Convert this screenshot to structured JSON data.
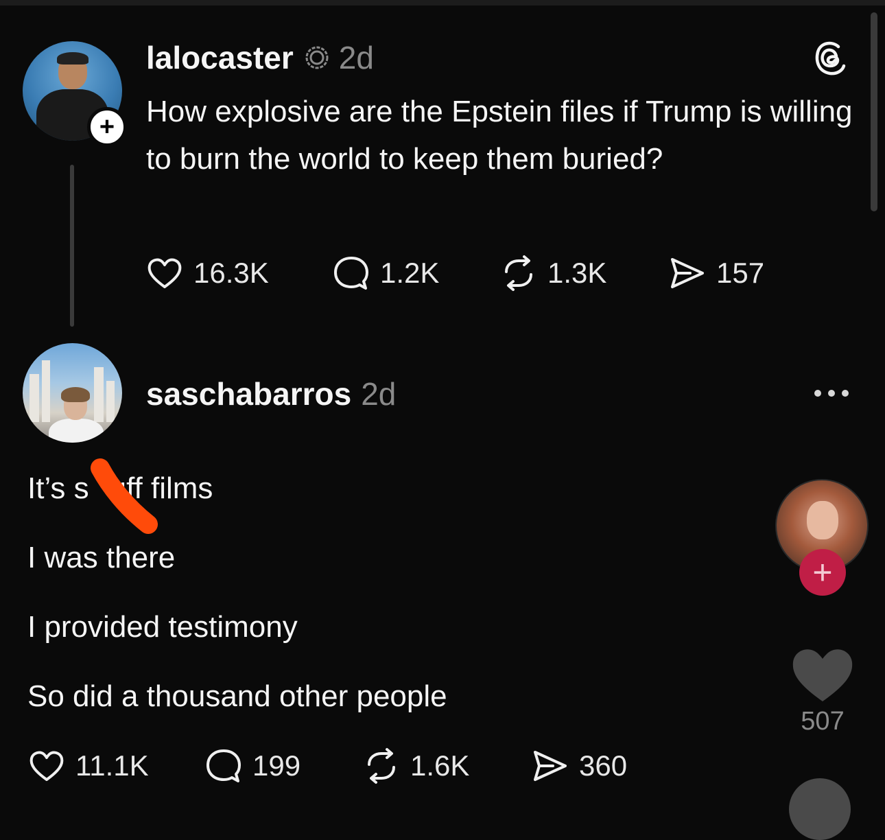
{
  "post": {
    "username": "lalocaster",
    "timestamp": "2d",
    "text": "How explosive are the Epstein files if Trump is willing to burn the world to keep them buried?",
    "follow_symbol": "+",
    "stats": {
      "likes": "16.3K",
      "replies": "1.2K",
      "reposts": "1.3K",
      "shares": "157"
    }
  },
  "reply": {
    "username": "saschabarros",
    "timestamp": "2d",
    "lines": [
      "It’s s",
      "I was there",
      "I provided testimony",
      "So did a thousand other people"
    ],
    "line1_tail": "uff films",
    "stats": {
      "likes": "11.1K",
      "replies": "199",
      "reposts": "1.6K",
      "shares": "360"
    }
  },
  "side_rail": {
    "follow_symbol": "+",
    "like_count": "507"
  },
  "colors": {
    "background": "#0a0a0a",
    "text": "#f5f5f5",
    "muted": "#8a8a8a",
    "accent_follow": "#c01e46",
    "scribble": "#ff4b0a"
  },
  "icons": {
    "like": "heart-icon",
    "reply": "speech-bubble-icon",
    "repost": "repost-icon",
    "share": "send-icon",
    "threads": "threads-logo-icon",
    "verified": "verified-badge-icon",
    "more": "more-dots-icon"
  }
}
